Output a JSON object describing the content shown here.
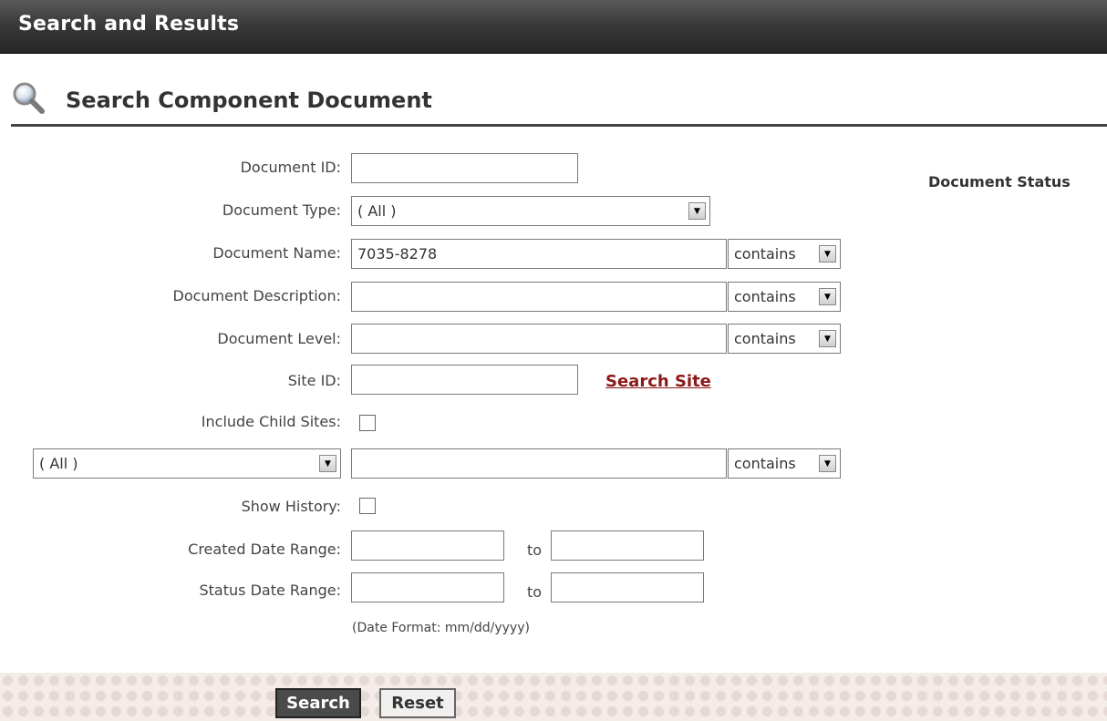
{
  "header": {
    "title": "Search and Results"
  },
  "section": {
    "title": "Search Component Document",
    "icon": "magnifier-icon"
  },
  "status_panel": {
    "title": "Document Status"
  },
  "form": {
    "document_id": {
      "label": "Document ID:",
      "value": ""
    },
    "document_type": {
      "label": "Document Type:",
      "selected": "( All )"
    },
    "document_name": {
      "label": "Document Name:",
      "value": "7035-8278",
      "operator": "contains"
    },
    "document_description": {
      "label": "Document Description:",
      "value": "",
      "operator": "contains"
    },
    "document_level": {
      "label": "Document Level:",
      "value": "",
      "operator": "contains"
    },
    "site_id": {
      "label": "Site ID:",
      "value": "",
      "link": "Search Site"
    },
    "include_child_sites": {
      "label": "Include Child Sites:",
      "checked": false
    },
    "custom_field": {
      "selected": "( All )",
      "value": "",
      "operator": "contains"
    },
    "show_history": {
      "label": "Show History:",
      "checked": false
    },
    "created_date_range": {
      "label": "Created Date Range:",
      "from": "",
      "to_label": "to",
      "to": ""
    },
    "status_date_range": {
      "label": "Status Date Range:",
      "from": "",
      "to_label": "to",
      "to": ""
    },
    "date_format_hint": "(Date Format: mm/dd/yyyy)"
  },
  "actions": {
    "search_label": "Search",
    "reset_label": "Reset"
  }
}
